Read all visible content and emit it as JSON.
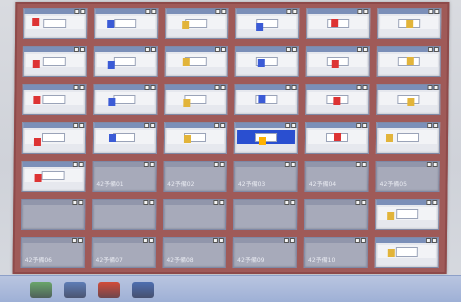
{
  "tiles": [
    {
      "label": "",
      "type": "filled"
    },
    {
      "label": "",
      "type": "filled"
    },
    {
      "label": "",
      "type": "filled"
    },
    {
      "label": "",
      "type": "filled"
    },
    {
      "label": "",
      "type": "filled"
    },
    {
      "label": "",
      "type": "filled"
    },
    {
      "label": "",
      "type": "filled"
    },
    {
      "label": "",
      "type": "filled"
    },
    {
      "label": "",
      "type": "filled"
    },
    {
      "label": "",
      "type": "filled"
    },
    {
      "label": "",
      "type": "filled"
    },
    {
      "label": "",
      "type": "filled"
    },
    {
      "label": "",
      "type": "filled"
    },
    {
      "label": "",
      "type": "filled"
    },
    {
      "label": "",
      "type": "filled"
    },
    {
      "label": "",
      "type": "filled"
    },
    {
      "label": "",
      "type": "filled"
    },
    {
      "label": "",
      "type": "filled"
    },
    {
      "label": "",
      "type": "filled"
    },
    {
      "label": "",
      "type": "filled"
    },
    {
      "label": "",
      "type": "filled"
    },
    {
      "label": "",
      "type": "active"
    },
    {
      "label": "",
      "type": "filled"
    },
    {
      "label": "",
      "type": "filled"
    },
    {
      "label": "",
      "type": "filled"
    },
    {
      "label": "42予備01",
      "type": "empty"
    },
    {
      "label": "42予備02",
      "type": "empty"
    },
    {
      "label": "42予備03",
      "type": "empty"
    },
    {
      "label": "42予備04",
      "type": "empty"
    },
    {
      "label": "42予備05",
      "type": "empty"
    },
    {
      "label": "",
      "type": "empty"
    },
    {
      "label": "",
      "type": "empty"
    },
    {
      "label": "",
      "type": "empty"
    },
    {
      "label": "",
      "type": "empty"
    },
    {
      "label": "",
      "type": "empty"
    },
    {
      "label": "",
      "type": "filled"
    },
    {
      "label": "42予備06",
      "type": "empty"
    },
    {
      "label": "42予備07",
      "type": "empty"
    },
    {
      "label": "42予備08",
      "type": "empty"
    },
    {
      "label": "42予備09",
      "type": "empty"
    },
    {
      "label": "42予備10",
      "type": "empty"
    },
    {
      "label": "",
      "type": "filled"
    }
  ],
  "colors": {
    "board": "#9f5a58",
    "tile": "#e6e8ee",
    "tile_empty": "#a7aaba",
    "active": "#2a4fd0",
    "taskbar": "#9eb0d6"
  },
  "taskbar": {
    "items": [
      {
        "name": "taskbar-item-1-icon",
        "color": "#6aa66a"
      },
      {
        "name": "taskbar-item-2-icon",
        "color": "#5e7db6"
      },
      {
        "name": "taskbar-item-3-icon",
        "color": "#d24c3a"
      },
      {
        "name": "taskbar-item-4-icon",
        "color": "#4e6fb0"
      }
    ]
  }
}
